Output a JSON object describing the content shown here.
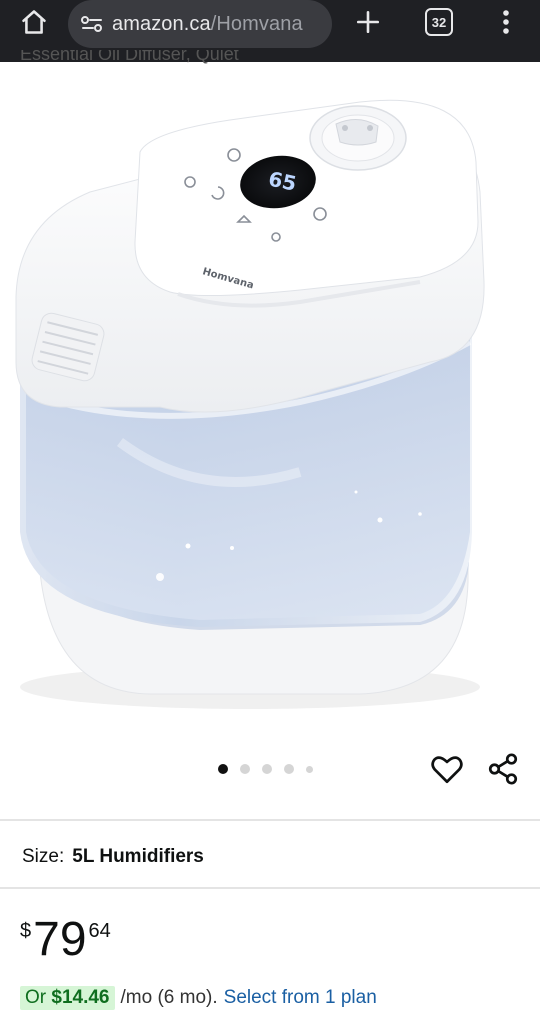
{
  "browser": {
    "url_domain": "amazon.ca",
    "url_path": "/Homvana",
    "tab_count": "32",
    "icons": [
      "home-icon",
      "site-settings-icon",
      "plus-icon",
      "tabs-icon",
      "overflow-menu-icon"
    ]
  },
  "product": {
    "cut_off_title": "Essential Oil Diffuser, Quiet",
    "image_alt": "Homvana humidifier",
    "brand_on_device": "Homvana",
    "display_reading": "65",
    "carousel": {
      "count": 5,
      "active_index": 0
    },
    "size_label": "Size:",
    "size_value": "5L Humidifiers",
    "price": {
      "symbol": "$",
      "whole": "79",
      "fraction": "64"
    },
    "monthly": {
      "prefix": "Or",
      "amount": "$14.46",
      "terms": "/mo (6 mo).",
      "link": "Select from 1 plan"
    }
  },
  "colors": {
    "chrome_bg": "#1f2024",
    "urlbar_bg": "#3a3b40",
    "link": "#1a5fa3",
    "plan_badge_bg": "#d6f5d6",
    "plan_badge_text": "#0f6e1f"
  }
}
